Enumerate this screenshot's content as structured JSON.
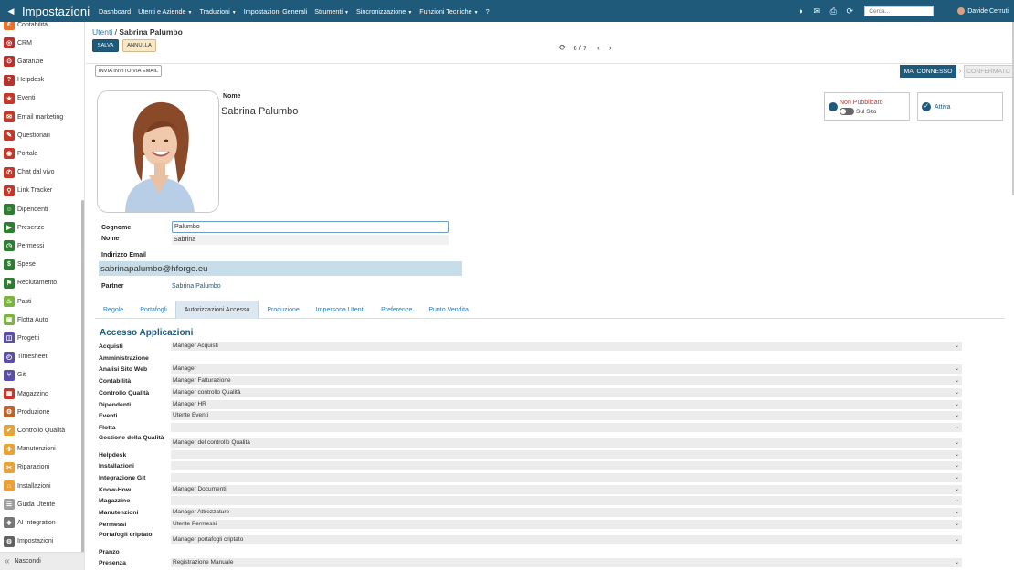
{
  "topbar": {
    "title": "Impostazioni",
    "menu": [
      {
        "label": "Dashboard",
        "caret": false
      },
      {
        "label": "Utenti e Aziende",
        "caret": true
      },
      {
        "label": "Traduzioni",
        "caret": true
      },
      {
        "label": "Impostazioni Generali",
        "caret": false
      },
      {
        "label": "Strumenti",
        "caret": true
      },
      {
        "label": "Sincronizzazione",
        "caret": true
      },
      {
        "label": "Funzioni Tecniche",
        "caret": true
      },
      {
        "label": "?",
        "caret": false
      }
    ],
    "search_placeholder": "Cerca...",
    "user_name": "Davide Cerruti"
  },
  "sidebar": {
    "items": [
      {
        "label": "Contabilità",
        "icon": "accounting-icon",
        "color": "#e8732a"
      },
      {
        "label": "CRM",
        "icon": "crm-icon",
        "color": "#b8322e"
      },
      {
        "label": "Garanzie",
        "icon": "warranty-icon",
        "color": "#b8322e"
      },
      {
        "label": "Helpdesk",
        "icon": "helpdesk-icon",
        "color": "#b8322e"
      },
      {
        "label": "Eventi",
        "icon": "events-icon",
        "color": "#c0392b"
      },
      {
        "label": "Email marketing",
        "icon": "email-marketing-icon",
        "color": "#c0392b"
      },
      {
        "label": "Questionari",
        "icon": "survey-icon",
        "color": "#c0392b"
      },
      {
        "label": "Portale",
        "icon": "portal-icon",
        "color": "#c0392b"
      },
      {
        "label": "Chat dal vivo",
        "icon": "live-chat-icon",
        "color": "#c0392b"
      },
      {
        "label": "Link Tracker",
        "icon": "link-tracker-icon",
        "color": "#c0392b"
      },
      {
        "label": "Dipendenti",
        "icon": "employees-icon",
        "color": "#2e7d32"
      },
      {
        "label": "Presenze",
        "icon": "attendance-icon",
        "color": "#2e7d32"
      },
      {
        "label": "Permessi",
        "icon": "time-off-icon",
        "color": "#2e7d32"
      },
      {
        "label": "Spese",
        "icon": "expenses-icon",
        "color": "#2e7d32"
      },
      {
        "label": "Reclutamento",
        "icon": "recruitment-icon",
        "color": "#2e7d32"
      },
      {
        "label": "Pasti",
        "icon": "meals-icon",
        "color": "#7cb342"
      },
      {
        "label": "Flotta Auto",
        "icon": "fleet-icon",
        "color": "#7cb342"
      },
      {
        "label": "Progetti",
        "icon": "projects-icon",
        "color": "#5c4ea3"
      },
      {
        "label": "Timesheet",
        "icon": "timesheet-icon",
        "color": "#5c4ea3"
      },
      {
        "label": "Git",
        "icon": "git-icon",
        "color": "#5c4ea3"
      },
      {
        "label": "Magazzino",
        "icon": "inventory-icon",
        "color": "#c0392b"
      },
      {
        "label": "Produzione",
        "icon": "manufacturing-icon",
        "color": "#c0622b"
      },
      {
        "label": "Controllo Qualità",
        "icon": "quality-icon",
        "color": "#e8a23a"
      },
      {
        "label": "Manutenzioni",
        "icon": "maintenance-icon",
        "color": "#e8a23a"
      },
      {
        "label": "Riparazioni",
        "icon": "repairs-icon",
        "color": "#e8a23a"
      },
      {
        "label": "Installazioni",
        "icon": "installations-icon",
        "color": "#e8a23a"
      },
      {
        "label": "Guida Utente",
        "icon": "user-guide-icon",
        "color": "#9e9e9e"
      },
      {
        "label": "AI Integration",
        "icon": "ai-integration-icon",
        "color": "#757575"
      },
      {
        "label": "Impostazioni",
        "icon": "settings-icon",
        "color": "#616161"
      }
    ],
    "hide_label": "Nascondi"
  },
  "main": {
    "breadcrumb_parent": "Utenti",
    "breadcrumb_sep": "/",
    "breadcrumb_current": "Sabrina Palumbo",
    "save_label": "SALVA",
    "cancel_label": "ANNULLA",
    "pager": "6 / 7",
    "invite_label": "INVIA INVITO VIA EMAIL",
    "status_active": "MAI CONNESSO",
    "status_next": "CONFERMATO"
  },
  "profile": {
    "name_label": "Nome",
    "name_value": "Sabrina Palumbo",
    "publish_status": "Non Pubblicato",
    "publish_toggle_label": "Sul Sito",
    "active_label": "Attiva"
  },
  "fields": {
    "cognome_label": "Cognome",
    "cognome_value": "Palumbo",
    "nome_label": "Nome",
    "nome_value": "Sabrina",
    "email_label": "Indirizzo Email",
    "email_value": "sabrinapalumbo@hforge.eu",
    "partner_label": "Partner",
    "partner_value": "Sabrina Palumbo"
  },
  "tabs": [
    {
      "label": "Regole",
      "active": false
    },
    {
      "label": "Portafogli",
      "active": false
    },
    {
      "label": "Autorizzazioni Accesso",
      "active": true
    },
    {
      "label": "Produzione",
      "active": false
    },
    {
      "label": "Impersona Utenti",
      "active": false
    },
    {
      "label": "Preferenze",
      "active": false
    },
    {
      "label": "Punto Vendita",
      "active": false
    }
  ],
  "access": {
    "title": "Accesso Applicazioni",
    "rows": [
      {
        "label": "Acquisti",
        "value": "Manager Acquisti"
      },
      {
        "label": "Amministrazione",
        "value": null
      },
      {
        "label": "Analisi Sito Web",
        "value": "Manager"
      },
      {
        "label": "Contabilità",
        "value": "Manager Fatturazione"
      },
      {
        "label": "Controllo Qualità",
        "value": "Manager controllo Qualità"
      },
      {
        "label": "Dipendenti",
        "value": "Manager HR"
      },
      {
        "label": "Eventi",
        "value": "Utente Eventi"
      },
      {
        "label": "Flotta",
        "value": ""
      },
      {
        "label": "Gestione della Qualità",
        "value": "Manager del controllo Qualità"
      },
      {
        "label": "Helpdesk",
        "value": ""
      },
      {
        "label": "Installazioni",
        "value": ""
      },
      {
        "label": "Integrazione Git",
        "value": ""
      },
      {
        "label": "Know-How",
        "value": "Manager Documenti"
      },
      {
        "label": "Magazzino",
        "value": ""
      },
      {
        "label": "Manutenzioni",
        "value": "Manager Attrezzature"
      },
      {
        "label": "Permessi",
        "value": "Utente Permessi"
      },
      {
        "label": "Portafogli criptato",
        "value": "Manager portafogli criptato"
      },
      {
        "label": "Pranzo",
        "value": null
      },
      {
        "label": "Presenza",
        "value": "Registrazione Manuale"
      }
    ]
  }
}
